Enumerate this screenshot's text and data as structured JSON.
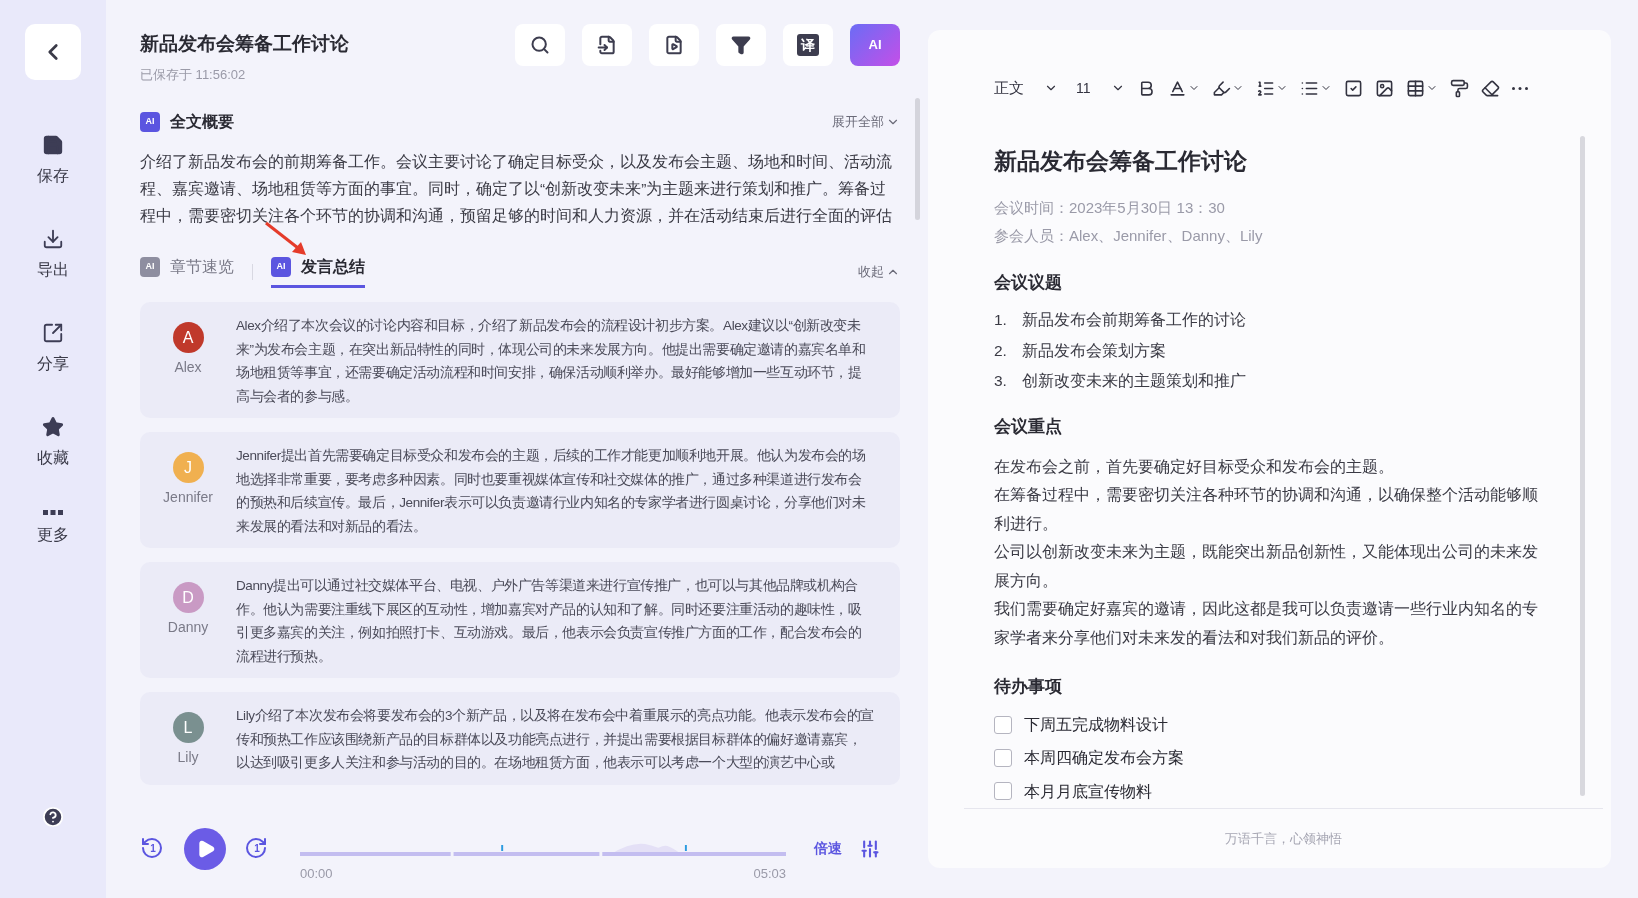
{
  "sidebar": {
    "items": [
      {
        "kind": "save",
        "label": "保存"
      },
      {
        "kind": "export",
        "label": "导出"
      },
      {
        "kind": "share",
        "label": "分享"
      },
      {
        "kind": "favorite",
        "label": "收藏"
      },
      {
        "kind": "more",
        "label": "更多"
      }
    ]
  },
  "header": {
    "title": "新品发布会筹备工作讨论",
    "saved": "已保存于 11:56:02",
    "tools": [
      {
        "kind": "search"
      },
      {
        "kind": "doc"
      },
      {
        "kind": "export"
      },
      {
        "kind": "filter"
      },
      {
        "kind": "translate",
        "label": "译"
      },
      {
        "kind": "ai",
        "label": "AI"
      }
    ]
  },
  "summary": {
    "icon_label": "AI",
    "title": "全文概要",
    "expand": "展开全部",
    "text": "介绍了新品发布会的前期筹备工作。会议主要讨论了确定目标受众，以及发布会主题、场地和时间、活动流程、嘉宾邀请、场地租赁等方面的事宜。同时，确定了以“创新改变未来”为主题来进行策划和推广。筹备过程中，需要密切关注各个环节的协调和沟通，预留足够的时间和人力资源，并在活动结束后进行全面的评估"
  },
  "tabs": [
    {
      "icon_label": "AI",
      "label": "章节速览",
      "selected": false
    },
    {
      "icon_label": "AI",
      "label": "发言总结",
      "selected": true
    }
  ],
  "collapse": "收起",
  "speakers": [
    {
      "name": "Alex",
      "initial": "A",
      "color": "#c0392b",
      "text": "Alex介绍了本次会议的讨论内容和目标，介绍了新品发布会的流程设计初步方案。Alex建议以“创新改变未来”为发布会主题，在突出新品特性的同时，体现公司的未来发展方向。他提出需要确定邀请的嘉宾名单和场地租赁等事宜，还需要确定活动流程和时间安排，确保活动顺利举办。最好能够增加一些互动环节，提高与会者的参与感。"
    },
    {
      "name": "Jennifer",
      "initial": "J",
      "color": "#f0b050",
      "text": "Jennifer提出首先需要确定目标受众和发布会的主题，后续的工作才能更加顺利地开展。他认为发布会的场地选择非常重要，要考虑多种因素。同时也要重视媒体宣传和社交媒体的推广，通过多种渠道进行发布会的预热和后续宣传。最后，Jennifer表示可以负责邀请行业内知名的专家学者进行圆桌讨论，分享他们对未来发展的看法和对新品的看法。"
    },
    {
      "name": "Danny",
      "initial": "D",
      "color": "#c99ac4",
      "text": "Danny提出可以通过社交媒体平台、电视、户外广告等渠道来进行宣传推广，也可以与其他品牌或机构合作。他认为需要注重线下展区的互动性，增加嘉宾对产品的认知和了解。同时还要注重活动的趣味性，吸引更多嘉宾的关注，例如拍照打卡、互动游戏。最后，他表示会负责宣传推广方面的工作，配合发布会的流程进行预热。"
    },
    {
      "name": "Lily",
      "initial": "L",
      "color": "#7a9090",
      "text": "Lily介绍了本次发布会将要发布会的3个新产品，以及将在发布会中着重展示的亮点功能。他表示发布会的宣传和预热工作应该围绕新产品的目标群体以及功能亮点进行，并提出需要根据目标群体的偏好邀请嘉宾，以达到吸引更多人关注和参与活动的目的。在场地租赁方面，他表示可以考虑一个大型的演艺中心或"
    }
  ],
  "player": {
    "back_label": "1",
    "forward_label": "1",
    "start": "00:00",
    "end": "05:03",
    "speed": "倍速",
    "playing": false
  },
  "editor": {
    "style": "正文",
    "size": "11",
    "tools": [
      {
        "kind": "bold"
      },
      {
        "kind": "color",
        "caret": true
      },
      {
        "kind": "highlight",
        "caret": true
      },
      {
        "kind": "ordered",
        "caret": true
      },
      {
        "kind": "bullets",
        "caret": true
      },
      {
        "kind": "task"
      },
      {
        "kind": "image"
      },
      {
        "kind": "table",
        "caret": true
      },
      {
        "kind": "painter"
      },
      {
        "kind": "eraser"
      },
      {
        "kind": "more"
      }
    ],
    "title": "新品发布会筹备工作讨论",
    "meta": [
      "会议时间：2023年5月30日 13：30",
      "参会人员：Alex、Jennifer、Danny、Lily"
    ],
    "sections": [
      {
        "heading": "会议议题",
        "kind": "ordered",
        "items": [
          "新品发布会前期筹备工作的讨论",
          "新品发布会策划方案",
          "创新改变未来的主题策划和推广"
        ],
        "numbers": [
          "1.",
          "2.",
          "3."
        ]
      },
      {
        "heading": "会议重点",
        "kind": "paragraphs",
        "items": [
          "在发布会之前，首先要确定好目标受众和发布会的主题。",
          "在筹备过程中，需要密切关注各种环节的协调和沟通，以确保整个活动能够顺利进行。",
          "公司以创新改变未来为主题，既能突出新品创新性，又能体现出公司的未来发展方向。",
          "我们需要确定好嘉宾的邀请，因此这都是我可以负责邀请一些行业内知名的专家学者来分享他们对未来发的看法和对我们新品的评价。"
        ]
      },
      {
        "heading": "待办事项",
        "kind": "todos",
        "todos": [
          {
            "text": "下周五完成物料设计",
            "checked": false
          },
          {
            "text": "本周四确定发布会方案",
            "checked": false
          },
          {
            "text": "本月月底宣传物料",
            "checked": false
          }
        ]
      }
    ],
    "footer": "万语千言，心领神悟"
  }
}
